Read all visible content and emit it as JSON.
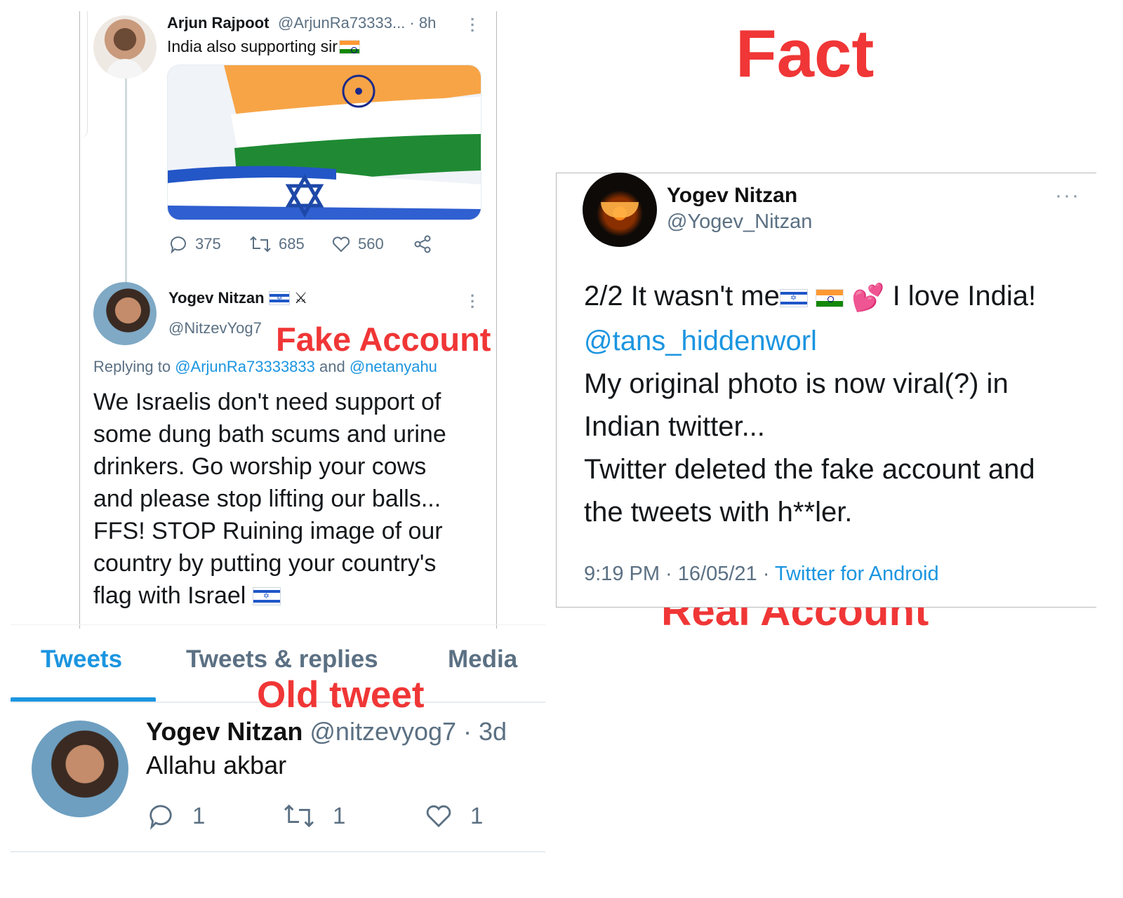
{
  "title": "Fact",
  "labels": {
    "fake": "Fake Account",
    "real": "Real Account",
    "old": "Old tweet"
  },
  "fake_thread": {
    "parent": {
      "name": "Arjun Rajpoot",
      "handle_time": "@ArjunRa73333... · 8h",
      "text": "India also supporting sir",
      "image_icon": "india-israel-flags-image",
      "actions": {
        "replies": "375",
        "retweets": "685",
        "likes": "560"
      }
    },
    "reply": {
      "name": "Yogev Nitzan",
      "name_suffix": "⚔",
      "handle": "@NitzevYog7",
      "replying_prefix": "Replying to ",
      "replying_to_1": "@ArjunRa73333833",
      "replying_and": " and ",
      "replying_to_2": "@netanyahu",
      "lines": [
        "We Israelis don't need support of",
        "some dung bath scums and urine",
        "drinkers. Go worship your cows",
        "and please stop lifting our balls...",
        "FFS! STOP Ruining image of our",
        "country by putting your country's",
        "flag with Israel"
      ]
    }
  },
  "real_tweet": {
    "name": "Yogev Nitzan",
    "handle": "@Yogev_Nitzan",
    "line1_a": "2/2 It wasn't me",
    "line1_b": "I love India!",
    "mention": "@tans_hiddenworl",
    "line3": "My original photo is now viral(?) in",
    "line4": "Indian twitter...",
    "line5": "Twitter deleted the fake account and",
    "line6": "the tweets with h**ler.",
    "meta_time": "9:19 PM · 16/05/21 · ",
    "meta_source": "Twitter for Android"
  },
  "old_tweet": {
    "tabs": [
      "Tweets",
      "Tweets & replies",
      "Media"
    ],
    "name": "Yogev Nitzan",
    "handle_time": "@nitzevyog7 · 3d",
    "text": "Allahu akbar",
    "actions": {
      "replies": "1",
      "retweets": "1",
      "likes": "1"
    }
  },
  "colors": {
    "label_red": "#f03636",
    "twitter_blue": "#1b95e0",
    "muted": "#5b7083"
  }
}
